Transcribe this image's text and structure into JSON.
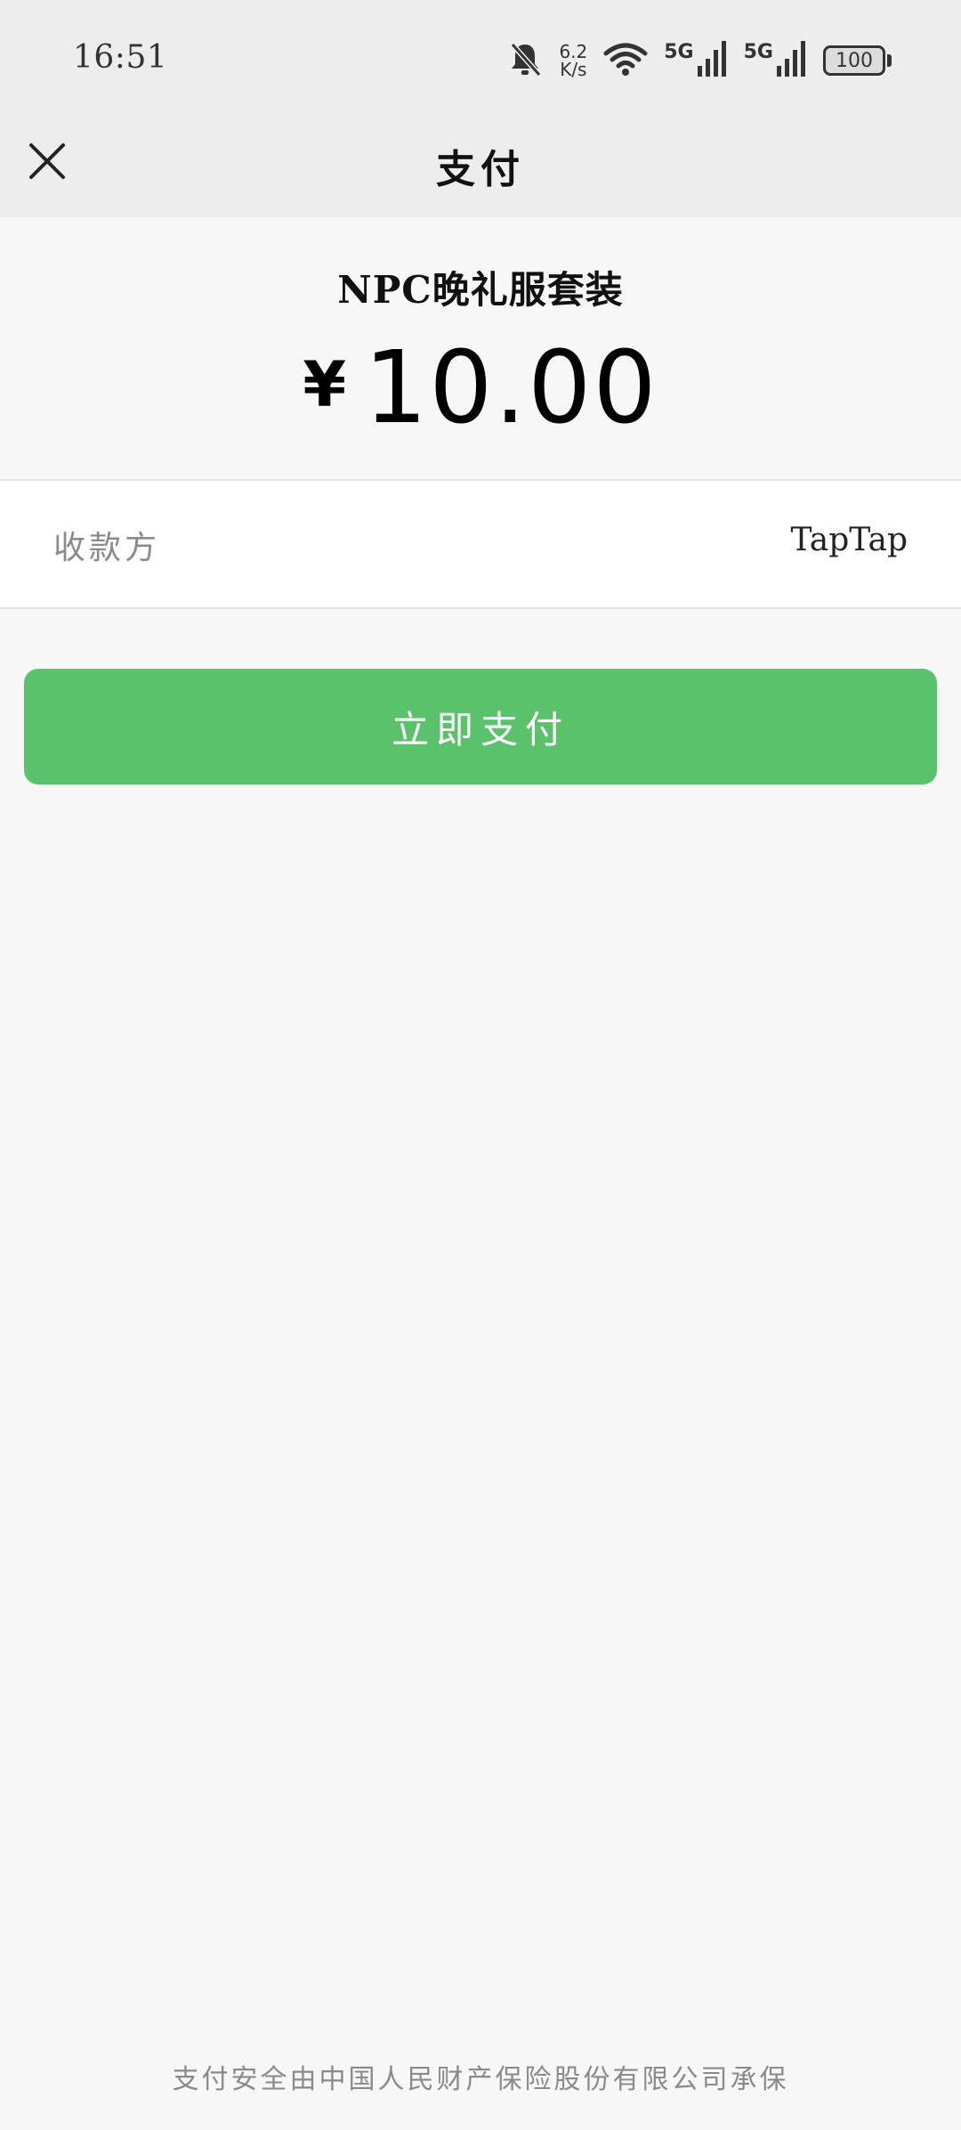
{
  "status_bar": {
    "time": "16:51",
    "net_speed_value": "6.2",
    "net_speed_unit": "K/s",
    "sim1_label": "5G",
    "sim2_label": "5G",
    "battery_level": "100",
    "icons": [
      "bell-muted-icon",
      "wifi-icon",
      "signal-icon",
      "battery-icon"
    ]
  },
  "nav": {
    "title": "支付",
    "close_icon": "close-icon"
  },
  "product": {
    "name": "NPC晚礼服套装",
    "currency_symbol": "¥",
    "amount": "10.00"
  },
  "payee": {
    "label": "收款方",
    "value": "TapTap"
  },
  "actions": {
    "pay_label": "立即支付"
  },
  "footer": {
    "note": "支付安全由中国人民财产保险股份有限公司承保"
  },
  "colors": {
    "accent": "#5bc26c",
    "header_bg": "#ededed",
    "page_bg": "#f7f7f7"
  }
}
